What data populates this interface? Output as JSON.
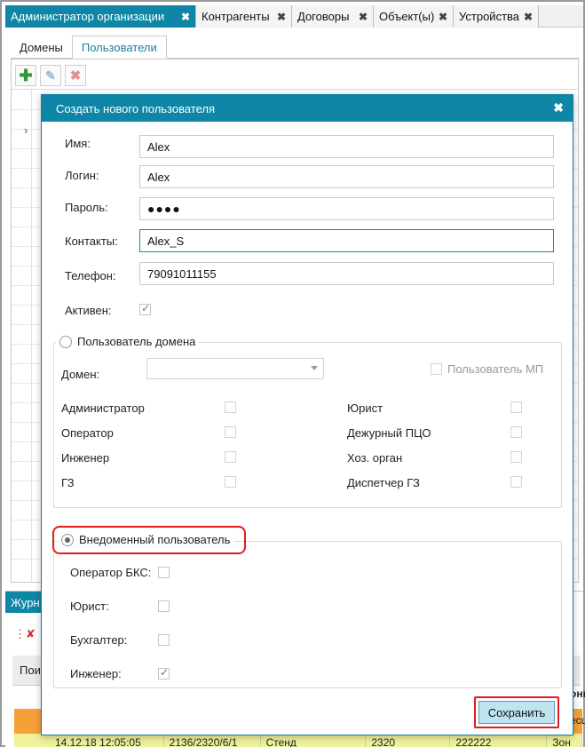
{
  "tabs": [
    {
      "label": "Администратор организации",
      "active": true
    },
    {
      "label": "Контрагенты",
      "active": false
    },
    {
      "label": "Договоры",
      "active": false
    },
    {
      "label": "Объект(ы)",
      "active": false
    },
    {
      "label": "Устройства",
      "active": false
    }
  ],
  "subtabs": [
    {
      "label": "Домены",
      "active": false
    },
    {
      "label": "Пользователи",
      "active": true
    }
  ],
  "toolbar_icons": [
    "add-icon",
    "edit-icon",
    "delete-icon"
  ],
  "journal": {
    "tab_label": "Журн",
    "header_cell": "Пои",
    "header_right": "оны",
    "orange_right": "есц",
    "row": [
      "14.12.18 12:05:05",
      "2136/2320/6/1",
      "Стенд",
      "2320",
      "222222",
      "Зон"
    ]
  },
  "modal": {
    "title": "Создать нового пользователя",
    "fields": {
      "name_label": "Имя:",
      "name_value": "Alex",
      "login_label": "Логин:",
      "login_value": "Alex",
      "password_label": "Пароль:",
      "password_value": "●●●●",
      "contacts_label": "Контакты:",
      "contacts_value": "Alex_S",
      "phone_label": "Телефон:",
      "phone_value": "79091011155",
      "active_label": "Активен:",
      "active_checked": true
    },
    "domain_user": {
      "radio_label": "Пользователь домена",
      "selected": false,
      "domain_label": "Домен:",
      "domain_value": "",
      "mp_user_label": "Пользователь МП",
      "roles_left": [
        "Администратор",
        "Оператор",
        "Инженер",
        "ГЗ"
      ],
      "roles_right": [
        "Юрист",
        "Дежурный ПЦО",
        "Хоз. орган",
        "Диспетчер ГЗ"
      ]
    },
    "nondomain_user": {
      "radio_label": "Внедоменный пользователь",
      "selected": true,
      "roles": [
        {
          "label": "Оператор БКС:",
          "checked": false
        },
        {
          "label": "Юрист:",
          "checked": false
        },
        {
          "label": "Бухгалтер:",
          "checked": false
        },
        {
          "label": "Инженер:",
          "checked": true
        }
      ]
    },
    "save_label": "Сохранить"
  },
  "colors": {
    "accent": "#0f86a5",
    "highlight": "#e11d1d",
    "journal_orange": "#f7a03a",
    "journal_yellow": "#eef29a"
  }
}
